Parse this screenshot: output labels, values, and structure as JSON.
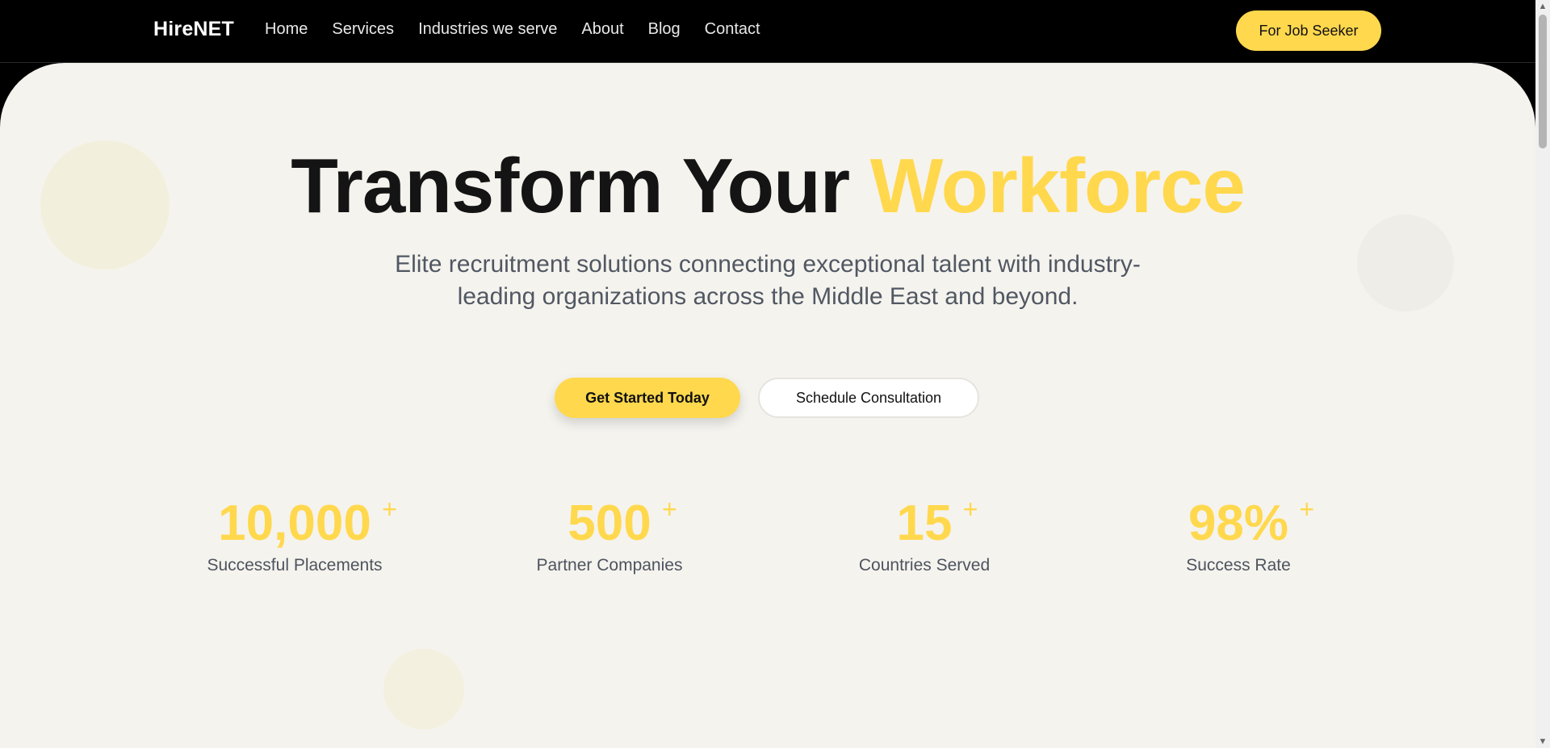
{
  "header": {
    "brand": "HireNET",
    "nav": [
      "Home",
      "Services",
      "Industries we serve",
      "About",
      "Blog",
      "Contact"
    ],
    "cta": "For Job Seeker"
  },
  "hero": {
    "title_main": "Transform Your ",
    "title_accent": "Workforce",
    "subtitle": "Elite recruitment solutions connecting exceptional talent with industry-leading organizations across the Middle East and beyond.",
    "primary_button": "Get Started Today",
    "secondary_button": "Schedule Consultation"
  },
  "stats": [
    {
      "value": "10,000",
      "suffix": "+",
      "label": "Successful Placements"
    },
    {
      "value": "500",
      "suffix": "+",
      "label": "Partner Companies"
    },
    {
      "value": "15",
      "suffix": "+",
      "label": "Countries Served"
    },
    {
      "value": "98%",
      "suffix": "+",
      "label": "Success Rate"
    }
  ],
  "colors": {
    "accent": "#ffd84d",
    "header_bg": "#000000",
    "hero_bg": "#f5f3ee",
    "text_dark": "#141414",
    "text_muted": "#515863"
  },
  "scrollbar": {
    "up_glyph": "▲",
    "down_glyph": "▼"
  }
}
